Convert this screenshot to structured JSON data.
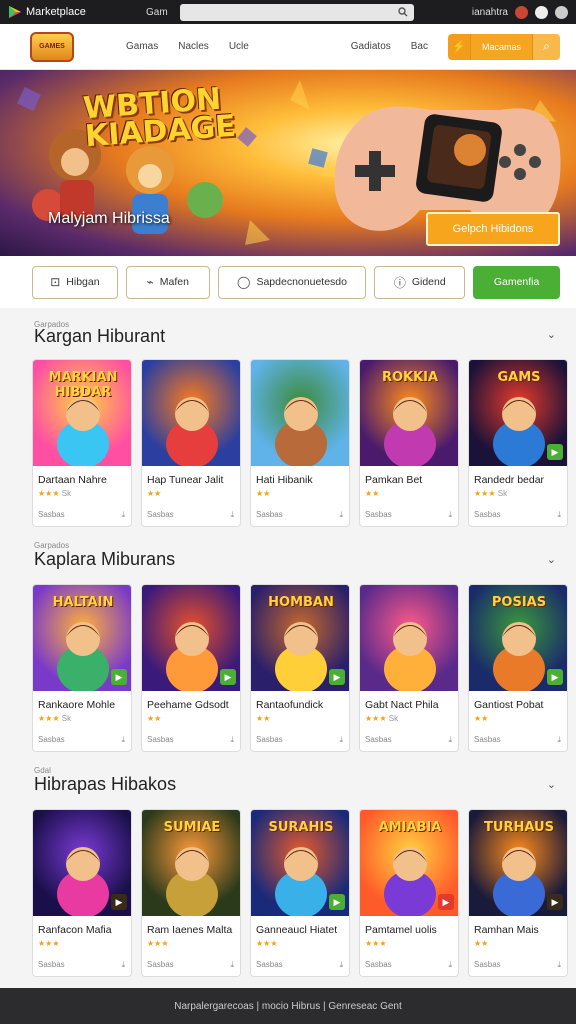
{
  "topbar": {
    "brand": "Marketplace",
    "search_label": "Gam",
    "search_placeholder": "",
    "right_label": "ianahtra"
  },
  "header": {
    "logo_text": "GAMES",
    "nav": [
      "Gamas",
      "Nacles",
      "Ucle"
    ],
    "nav_right": [
      "Gadiatos",
      "Bac"
    ],
    "cta_label": "Macamas"
  },
  "hero": {
    "title_line1": "WBTION",
    "title_line2": "KIADAGE",
    "caption": "Malyjam Hibrissa",
    "button": "Gelpch Hibidons"
  },
  "filters": [
    {
      "icon": "bag-icon",
      "glyph": "👜",
      "label": "Hibgan"
    },
    {
      "icon": "link-icon",
      "glyph": "⌁",
      "label": "Mafen"
    },
    {
      "icon": "chat-icon",
      "glyph": "◯",
      "label": "Sapdecnonuetesdo"
    },
    {
      "icon": "info-icon",
      "glyph": "ⓘ",
      "label": "Gidend"
    },
    {
      "icon": "",
      "glyph": "",
      "label": "Gamenfia"
    }
  ],
  "sections": [
    {
      "small": "Garpados",
      "title": "Kargan Hiburant",
      "cards": [
        {
          "thumb": "MARKIAN HIBDAR",
          "title": "Dartaan Nahre",
          "stars": "★★★",
          "count": "Sk",
          "foot": "Sasbas",
          "badge": ""
        },
        {
          "thumb": "",
          "title": "Hap Tunear Jalit",
          "stars": "★★",
          "count": "",
          "foot": "Sasbas",
          "badge": ""
        },
        {
          "thumb": "",
          "title": "Hati Hibanik",
          "stars": "★★",
          "count": "",
          "foot": "Sasbas",
          "badge": ""
        },
        {
          "thumb": "ROKKIA",
          "title": "Pamkan Bet",
          "stars": "★★",
          "count": "",
          "foot": "Sasbas",
          "badge": ""
        },
        {
          "thumb": "GAMS",
          "title": "Randedr bedar",
          "stars": "★★★",
          "count": "Sk",
          "foot": "Sasbas",
          "badge": "green"
        }
      ]
    },
    {
      "small": "Garpados",
      "title": "Kaplara Miburans",
      "cards": [
        {
          "thumb": "HALTAIN",
          "title": "Rankaore Mohle",
          "stars": "★★★",
          "count": "Sk",
          "foot": "Sasbas",
          "badge": "green"
        },
        {
          "thumb": "",
          "title": "Peehame Gdsodt",
          "stars": "★★",
          "count": "",
          "foot": "Sasbas",
          "badge": "green"
        },
        {
          "thumb": "HOMBAN",
          "title": "Rantaofundick",
          "stars": "★★",
          "count": "",
          "foot": "Sasbas",
          "badge": "green"
        },
        {
          "thumb": "",
          "title": "Gabt Nact Phila",
          "stars": "★★★",
          "count": "Sk",
          "foot": "Sasbas",
          "badge": ""
        },
        {
          "thumb": "POSIAS",
          "title": "Gantiost Pobat",
          "stars": "★★",
          "count": "",
          "foot": "Sasbas",
          "badge": "green"
        }
      ]
    },
    {
      "small": "Gdal",
      "title": "Hibrapas Hibakos",
      "cards": [
        {
          "thumb": "",
          "title": "Ranfacon Mafia",
          "stars": "★★★",
          "count": "",
          "foot": "Sasbas",
          "badge": "dark"
        },
        {
          "thumb": "SUMIAE",
          "title": "Ram Iaenes Malta",
          "stars": "★★★",
          "count": "",
          "foot": "Sasbas",
          "badge": ""
        },
        {
          "thumb": "SURAHIS",
          "title": "Ganneaucl Hiatet",
          "stars": "★★★",
          "count": "",
          "foot": "Sasbas",
          "badge": "green"
        },
        {
          "thumb": "AMIABIA",
          "title": "Pamtamel uolis",
          "stars": "★★★",
          "count": "",
          "foot": "Sasbas",
          "badge": "red"
        },
        {
          "thumb": "TURHAUS",
          "title": "Ramhan Mais",
          "stars": "★★",
          "count": "",
          "foot": "Sasbas",
          "badge": "dark"
        }
      ]
    }
  ],
  "footer": "Narpalergarecoas  |  mocio Hibrus  |  Genreseac Gent",
  "colors": {
    "accent": "#f4a623",
    "green": "#4caf35",
    "dark": "#1d1d1f"
  }
}
